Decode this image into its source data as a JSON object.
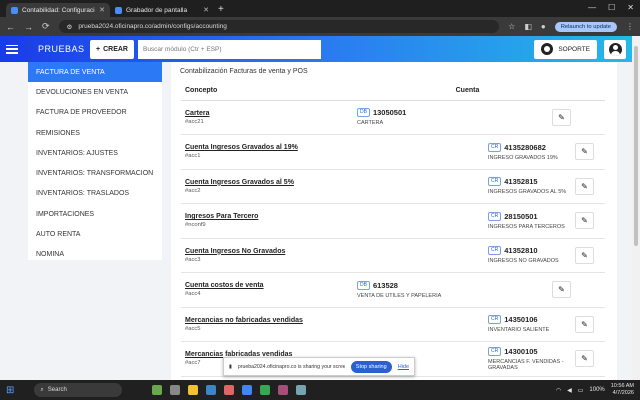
{
  "browser": {
    "tabs": [
      {
        "title": "Contabilidad: Configuraciones",
        "active": true
      },
      {
        "title": "Grabador de pantalla",
        "active": false
      }
    ],
    "url": "prueba2024.oficinapro.co/admin/configs/accounting",
    "relaunch_label": "Relaunch to update"
  },
  "header": {
    "brand": "PRUEBAS",
    "crear_label": "CREAR",
    "search_placeholder": "Buscar módulo (Ctr + ESP)",
    "soporte_label": "SOPORTE"
  },
  "sidebar": {
    "items": [
      {
        "label": "FACTURA DE VENTA",
        "active": true
      },
      {
        "label": "DEVOLUCIONES EN VENTA"
      },
      {
        "label": "FACTURA DE PROVEEDOR"
      },
      {
        "label": "REMISIONES"
      },
      {
        "label": "INVENTARIOS: AJUSTES"
      },
      {
        "label": "INVENTARIOS: TRANSFORMACION"
      },
      {
        "label": "INVENTARIOS: TRASLADOS"
      },
      {
        "label": "IMPORTACIONES"
      },
      {
        "label": "AUTO RENTA"
      },
      {
        "label": "NOMINA"
      }
    ]
  },
  "main": {
    "title": "Contabilización Facturas de venta y POS",
    "headers": {
      "concepto": "Concepto",
      "cuenta": "Cuenta"
    },
    "rows": [
      {
        "name": "Cartera",
        "code": "#acc21",
        "type": "DB",
        "number": "13050501",
        "desc": "CARTERA"
      },
      {
        "name": "Cuenta Ingresos Gravados al 19%",
        "code": "#acc1",
        "type": "CR",
        "number": "4135280682",
        "desc": "INGRESO GRAVADOS 19%"
      },
      {
        "name": "Cuenta Ingresos Gravados al 5%",
        "code": "#acc2",
        "type": "CR",
        "number": "41352815",
        "desc": "INGRESOS GRAVADOS AL 5%"
      },
      {
        "name": "Ingresos Para Tercero",
        "code": "#nconf9",
        "type": "CR",
        "number": "28150501",
        "desc": "INGRESOS PARA TERCEROS"
      },
      {
        "name": "Cuenta Ingresos No Gravados",
        "code": "#acc3",
        "type": "CR",
        "number": "41352810",
        "desc": "INGRESOS NO GRAVADOS"
      },
      {
        "name": "Cuenta costos de venta",
        "code": "#acc4",
        "type": "DB",
        "number": "613528",
        "desc": "VENTA DE UTILES Y PAPELERIA"
      },
      {
        "name": "Mercancias no fabricadas vendidas",
        "code": "#acc5",
        "type": "CR",
        "number": "14350106",
        "desc": "INVENTARIO SALIENTE"
      },
      {
        "name": "Mercancias fabricadas vendidas",
        "code": "#acc7",
        "type": "CR",
        "number": "14300105",
        "desc": "MERCANCIAS F. VENDIDAS - GRAVADAS"
      }
    ]
  },
  "share_bar": {
    "text": "prueba2024.oficinapro.co is sharing your screen.",
    "stop_label": "Stop sharing",
    "hide_label": "Hide"
  },
  "taskbar": {
    "search_label": "Search",
    "time": "10:56 AM",
    "date": "4/7/2026",
    "battery": "100%"
  },
  "icons": {
    "edit": "edit-icon",
    "soporte": "support-icon",
    "user": "user-icon"
  },
  "colors": {
    "accent": "#2c79f6",
    "header_start": "#1a3be8",
    "header_end": "#23b9e8"
  }
}
